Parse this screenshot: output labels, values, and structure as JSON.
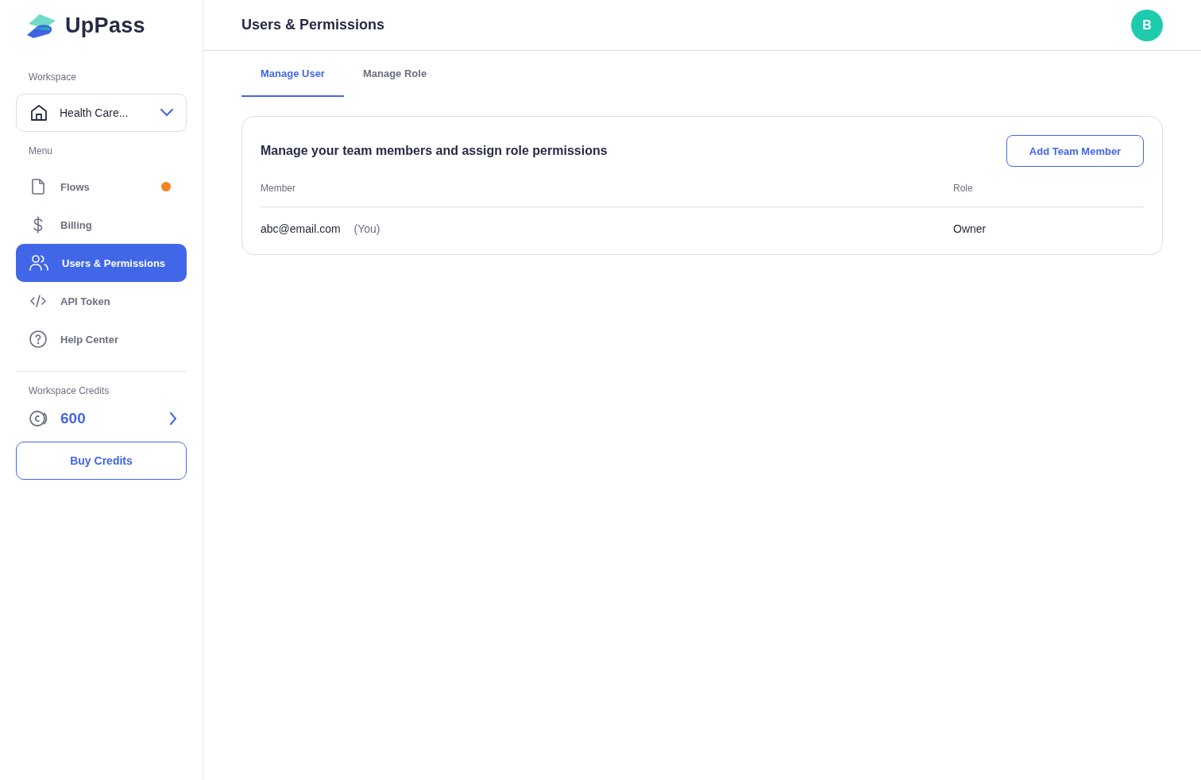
{
  "brand": {
    "name": "UpPass"
  },
  "sidebar": {
    "workspace_label": "Workspace",
    "workspace": "Health Care...",
    "menu_label": "Menu",
    "items": [
      {
        "label": "Flows",
        "selected": false,
        "dot": true
      },
      {
        "label": "Billing",
        "selected": false,
        "dot": false
      },
      {
        "label": "Users & Permissions",
        "selected": true,
        "dot": false
      },
      {
        "label": "API Token",
        "selected": false,
        "dot": false
      },
      {
        "label": "Help Center",
        "selected": false,
        "dot": false
      }
    ],
    "credits_label": "Workspace Credits",
    "credits": "600",
    "buy_button": "Buy Credits"
  },
  "header": {
    "title": "Users & Permissions",
    "avatar": "B"
  },
  "tabs": [
    {
      "label": "Manage User",
      "selected": true
    },
    {
      "label": "Manage Role",
      "selected": false
    }
  ],
  "card": {
    "title": "Manage your team members and assign role permissions",
    "add_button": "Add Team Member",
    "columns": [
      "Member",
      "Role"
    ],
    "rows": [
      {
        "member": "abc@email.com",
        "note": "(You)",
        "role": "Owner"
      }
    ]
  }
}
